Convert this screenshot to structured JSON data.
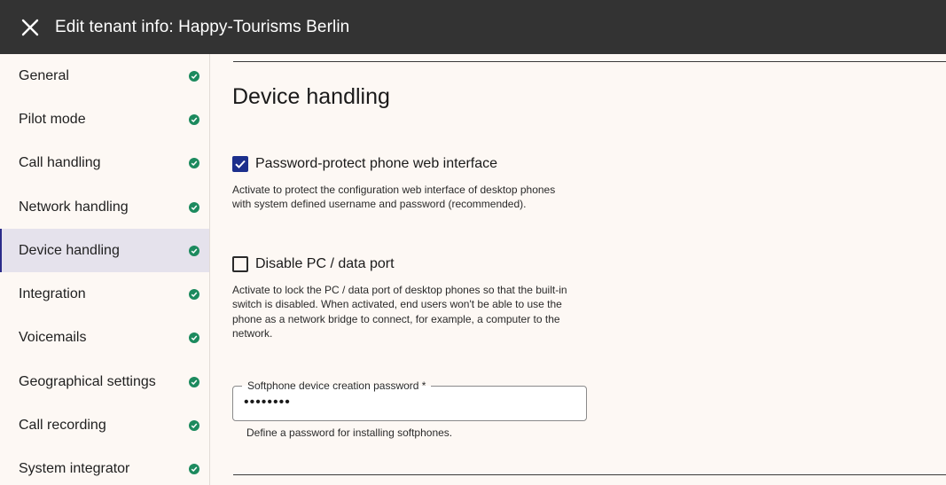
{
  "header": {
    "title": "Edit tenant info: Happy-Tourisms Berlin",
    "close_icon": "close-icon"
  },
  "sidebar": {
    "active": "Device handling",
    "items": [
      {
        "label": "General",
        "status": "complete"
      },
      {
        "label": "Pilot mode",
        "status": "complete"
      },
      {
        "label": "Call handling",
        "status": "complete"
      },
      {
        "label": "Network handling",
        "status": "complete"
      },
      {
        "label": "Device handling",
        "status": "complete"
      },
      {
        "label": "Integration",
        "status": "complete"
      },
      {
        "label": "Voicemails",
        "status": "complete"
      },
      {
        "label": "Geographical settings",
        "status": "complete"
      },
      {
        "label": "Call recording",
        "status": "complete"
      },
      {
        "label": "System integrator",
        "status": "complete"
      }
    ]
  },
  "main": {
    "title": "Device handling",
    "options": [
      {
        "label": "Password-protect phone web interface",
        "checked": true,
        "description": "Activate to protect the configuration web interface of desktop phones with system defined username and password (recommended)."
      },
      {
        "label": "Disable PC / data port",
        "checked": false,
        "description": "Activate to lock the PC / data port of desktop phones so that the built-in switch is disabled. When activated, end users won't be able to use the phone as a network bridge to connect, for example, a computer to the network."
      }
    ],
    "password_field": {
      "label": "Softphone device creation password *",
      "value": "••••••••",
      "helper": "Define a password for installing softphones."
    }
  },
  "colors": {
    "topbar": "#333333",
    "background": "#fdf8f4",
    "active_nav": "#e5e2ec",
    "status_green": "#1c8a5e",
    "checkbox_blue": "#1c2f8c"
  }
}
